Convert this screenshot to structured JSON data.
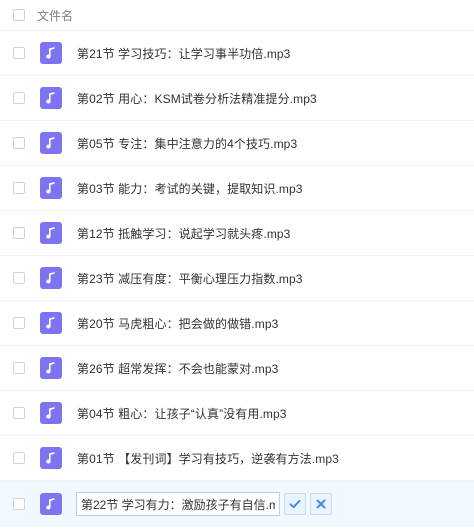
{
  "header": {
    "column_label": "文件名"
  },
  "files": [
    {
      "name": "第21节 学习技巧：让学习事半功倍.mp3"
    },
    {
      "name": "第02节 用心：KSM试卷分析法精准提分.mp3"
    },
    {
      "name": "第05节 专注：集中注意力的4个技巧.mp3"
    },
    {
      "name": "第03节 能力：考试的关键，提取知识.mp3"
    },
    {
      "name": "第12节 抵触学习：说起学习就头疼.mp3"
    },
    {
      "name": "第23节 减压有度：平衡心理压力指数.mp3"
    },
    {
      "name": "第20节 马虎粗心：把会做的做错.mp3"
    },
    {
      "name": "第26节 超常发挥：不会也能蒙对.mp3"
    },
    {
      "name": "第04节 粗心：让孩子“认真”没有用.mp3"
    },
    {
      "name": "第01节 【发刊词】学习有技巧，逆袭有方法.mp3"
    }
  ],
  "rename": {
    "value": "第22节 学习有力：激励孩子有自信.m"
  },
  "colors": {
    "icon": "#7e73f0",
    "accent": "#3b8fe8"
  },
  "icons": {
    "file": "music-note-icon",
    "confirm": "check-icon",
    "cancel": "close-icon"
  }
}
